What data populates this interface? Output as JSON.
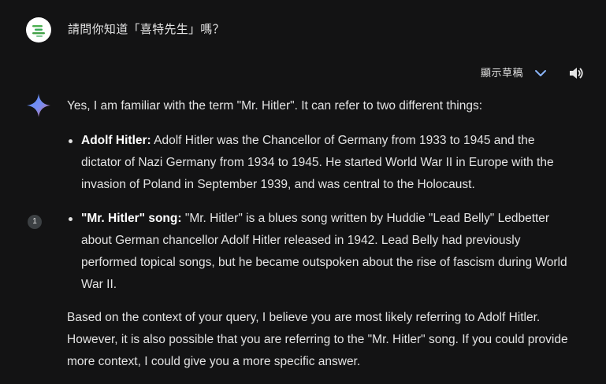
{
  "user_message": {
    "avatar_icon": "gemini-lines-logo-icon",
    "text": "請問你知道「喜特先生」嗎？"
  },
  "toolbar": {
    "drafts_label": "顯示草稿",
    "drafts_icon": "chevron-down-icon",
    "speaker_icon": "speaker-icon"
  },
  "response": {
    "assistant_icon": "gemini-sparkle-icon",
    "intro": "Yes, I am familiar with the term \"Mr. Hitler\". It can refer to two different things:",
    "items": [
      {
        "term": "Adolf Hitler:",
        "text": " Adolf Hitler was the Chancellor of Germany from 1933 to 1945 and the dictator of Nazi Germany from 1934 to 1945. He started World War II in Europe with the invasion of Poland in September 1939, and was central to the Holocaust."
      },
      {
        "term": "\"Mr. Hitler\" song:",
        "text": " \"Mr. Hitler\" is a blues song written by Huddie \"Lead Belly\" Ledbetter about German chancellor Adolf Hitler released in 1942. Lead Belly had previously performed topical songs, but he became outspoken about the rise of fascism during World War II."
      }
    ],
    "closing": "Based on the context of your query, I believe you are most likely referring to Adolf Hitler. However, it is also possible that you are referring to the \"Mr. Hitler\" song. If you could provide more context, I could give you a more specific answer.",
    "citation_number": "1"
  },
  "colors": {
    "background": "#131314",
    "text": "#e3e3e3",
    "accent_blue": "#8ab4f8",
    "citation_bg": "#3c4043"
  }
}
